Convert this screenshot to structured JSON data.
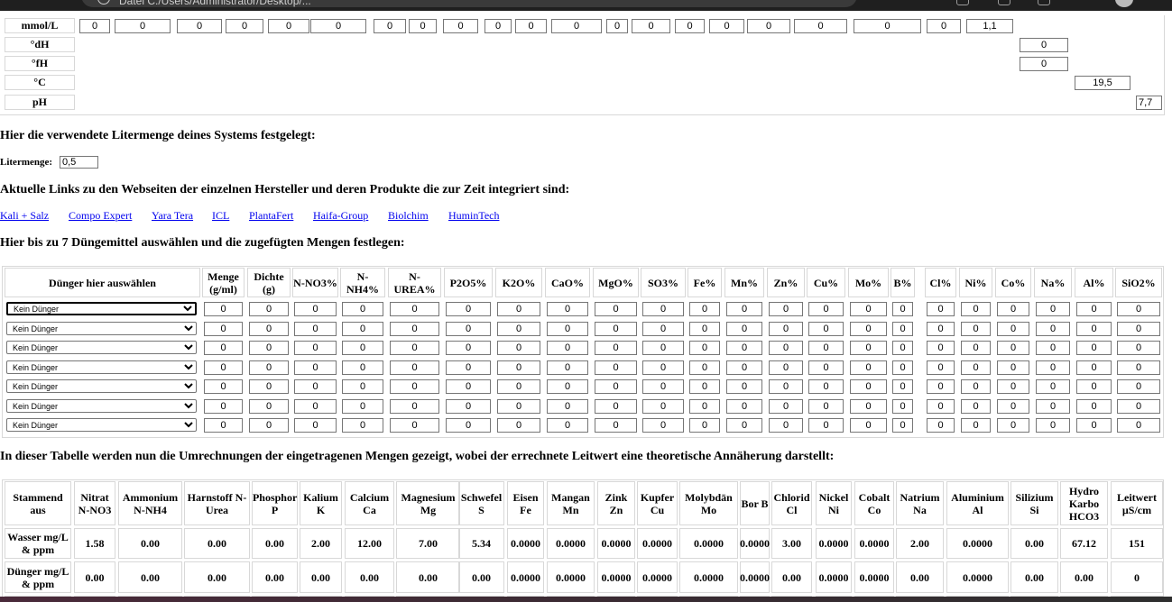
{
  "browser": {
    "url_fragment": "Datei    C:/Users/Administrator/Desktop/..."
  },
  "params": {
    "mmol_label": "mmol/L",
    "dh_label": "°dH",
    "fh_label": "°fH",
    "c_label": "°C",
    "ph_label": "pH",
    "mmol_values": [
      "0",
      "0",
      "0",
      "0",
      "0",
      "0",
      "0",
      "0",
      "0",
      "0",
      "0",
      "0",
      "0",
      "0",
      "0",
      "0",
      "0",
      "0",
      "0",
      "0",
      "0",
      "1,1"
    ],
    "dh_value": "0",
    "fh_value": "0",
    "c_value": "19,5",
    "ph_value": "7,7"
  },
  "headings": {
    "liter_heading": "Hier die verwendete Litermenge deines Systems festgelegt:",
    "links_heading": "Aktuelle Links zu den Webseiten der einzelnen Hersteller und deren Produkte die zur Zeit integriert sind:",
    "select_heading": "Hier bis zu 7 Düngemittel auswählen und die zugefügten Mengen festlegen:",
    "results_heading": "In dieser Tabelle werden nun die Umrechnungen der eingetragenen Mengen gezeigt, wobei der errechnete Leitwert eine theoretische Annäherung darstellt:"
  },
  "liter": {
    "label": "Litermenge:",
    "value": "0,5"
  },
  "links": [
    "Kali + Salz",
    "Compo Expert",
    "Yara Tera",
    "ICL",
    "PlantaFert",
    "Haifa-Group",
    "Biolchim",
    "HuminTech"
  ],
  "fert": {
    "headers": [
      "Dünger hier auswählen",
      "Menge (g/ml)",
      "Dichte (g)",
      "N-NO3%",
      "N-NH4%",
      "N-UREA%",
      "P2O5%",
      "K2O%",
      "CaO%",
      "MgO%",
      "SO3%",
      "Fe%",
      "Mn%",
      "Zn%",
      "Cu%",
      "Mo%",
      "B%",
      "Cl%",
      "Ni%",
      "Co%",
      "Na%",
      "Al%",
      "SiO2%"
    ],
    "rows": [
      {
        "select": "Kein Dünger",
        "values": [
          "0",
          "0",
          "0",
          "0",
          "0",
          "0",
          "0",
          "0",
          "0",
          "0",
          "0",
          "0",
          "0",
          "0",
          "0",
          "0",
          "0",
          "0",
          "0",
          "0",
          "0",
          "0"
        ]
      },
      {
        "select": "Kein Dünger",
        "values": [
          "0",
          "0",
          "0",
          "0",
          "0",
          "0",
          "0",
          "0",
          "0",
          "0",
          "0",
          "0",
          "0",
          "0",
          "0",
          "0",
          "0",
          "0",
          "0",
          "0",
          "0",
          "0"
        ]
      },
      {
        "select": "Kein Dünger",
        "values": [
          "0",
          "0",
          "0",
          "0",
          "0",
          "0",
          "0",
          "0",
          "0",
          "0",
          "0",
          "0",
          "0",
          "0",
          "0",
          "0",
          "0",
          "0",
          "0",
          "0",
          "0",
          "0"
        ]
      },
      {
        "select": "Kein Dünger",
        "values": [
          "0",
          "0",
          "0",
          "0",
          "0",
          "0",
          "0",
          "0",
          "0",
          "0",
          "0",
          "0",
          "0",
          "0",
          "0",
          "0",
          "0",
          "0",
          "0",
          "0",
          "0",
          "0"
        ]
      },
      {
        "select": "Kein Dünger",
        "values": [
          "0",
          "0",
          "0",
          "0",
          "0",
          "0",
          "0",
          "0",
          "0",
          "0",
          "0",
          "0",
          "0",
          "0",
          "0",
          "0",
          "0",
          "0",
          "0",
          "0",
          "0",
          "0"
        ]
      },
      {
        "select": "Kein Dünger",
        "values": [
          "0",
          "0",
          "0",
          "0",
          "0",
          "0",
          "0",
          "0",
          "0",
          "0",
          "0",
          "0",
          "0",
          "0",
          "0",
          "0",
          "0",
          "0",
          "0",
          "0",
          "0",
          "0"
        ]
      },
      {
        "select": "Kein Dünger",
        "values": [
          "0",
          "0",
          "0",
          "0",
          "0",
          "0",
          "0",
          "0",
          "0",
          "0",
          "0",
          "0",
          "0",
          "0",
          "0",
          "0",
          "0",
          "0",
          "0",
          "0",
          "0",
          "0"
        ]
      }
    ]
  },
  "results": {
    "headers": [
      "Stammend aus",
      "Nitrat N-NO3",
      "Ammonium N-NH4",
      "Harnstoff N-Urea",
      "Phosphor P",
      "Kalium K",
      "Calcium Ca",
      "Magnesium Mg",
      "Schwefel S",
      "Eisen Fe",
      "Mangan Mn",
      "Zink Zn",
      "Kupfer Cu",
      "Molybdän Mo",
      "Bor B",
      "Chlorid Cl",
      "Nickel Ni",
      "Cobalt Co",
      "Natrium Na",
      "Aluminium Al",
      "Silizium Si",
      "Hydro Karbo HCO3",
      "Leitwert µS/cm"
    ],
    "rows": [
      [
        "Wasser mg/L & ppm",
        "1.58",
        "0.00",
        "0.00",
        "0.00",
        "2.00",
        "12.00",
        "7.00",
        "5.34",
        "0.0000",
        "0.0000",
        "0.0000",
        "0.0000",
        "0.0000",
        "0.0000",
        "3.00",
        "0.0000",
        "0.0000",
        "2.00",
        "0.0000",
        "0.00",
        "67.12",
        "151"
      ],
      [
        "Dünger mg/L & ppm",
        "0.00",
        "0.00",
        "0.00",
        "0.00",
        "0.00",
        "0.00",
        "0.00",
        "0.00",
        "0.0000",
        "0.0000",
        "0.0000",
        "0.0000",
        "0.0000",
        "0.0000",
        "0.00",
        "0.0000",
        "0.0000",
        "0.00",
        "0.0000",
        "0.00",
        "0.00",
        "0"
      ]
    ]
  }
}
